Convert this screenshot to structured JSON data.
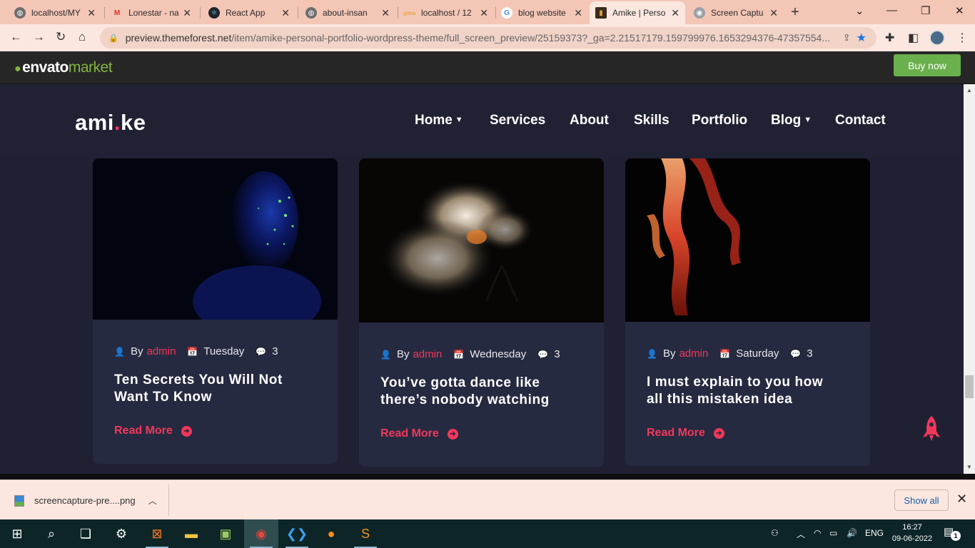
{
  "browser": {
    "tabs": [
      {
        "title": "localhost/MY",
        "icon": "globe-icon"
      },
      {
        "title": "Lonestar - na",
        "icon": "gmail-icon"
      },
      {
        "title": "React App",
        "icon": "react-icon"
      },
      {
        "title": "about-insan",
        "icon": "globe-icon"
      },
      {
        "title": "localhost / 12",
        "icon": "phpmyadmin-icon"
      },
      {
        "title": "blog website",
        "icon": "google-icon"
      },
      {
        "title": "Amike | Perso",
        "icon": "amike-icon",
        "active": true
      },
      {
        "title": "Screen Captu",
        "icon": "screen-capture-icon"
      }
    ],
    "url_host": "preview.themeforest.net",
    "url_path": "/item/amike-personal-portfolio-wordpress-theme/full_screen_preview/25159373?_ga=2.21517179.159799976.1653294376-47357554..."
  },
  "envato": {
    "logo_main": "envato",
    "logo_sub": "market",
    "buy_label": "Buy now",
    "brand_color": "#82b541"
  },
  "site": {
    "logo_left": "ami",
    "logo_dot": ".",
    "logo_right": "ke",
    "accent": "#f2385a",
    "nav": [
      {
        "label": "Home",
        "dropdown": true
      },
      {
        "label": "Services"
      },
      {
        "label": "About"
      },
      {
        "label": "Skills"
      },
      {
        "label": "Portfolio"
      },
      {
        "label": "Blog",
        "dropdown": true
      },
      {
        "label": "Contact"
      }
    ]
  },
  "posts": [
    {
      "by": "By",
      "author": "admin",
      "day": "Tuesday",
      "comments": "3",
      "title_line1": "Ten Secrets You Will Not",
      "title_line2": "Want To Know",
      "read_more": "Read More"
    },
    {
      "by": "By",
      "author": "admin",
      "day": "Wednesday",
      "comments": "3",
      "title_line1": "You’ve gotta dance like",
      "title_line2": "there’s nobody watching",
      "read_more": "Read More"
    },
    {
      "by": "By",
      "author": "admin",
      "day": "Saturday",
      "comments": "3",
      "title_line1": "I must explain to you how",
      "title_line2": "all this mistaken idea",
      "read_more": "Read More"
    }
  ],
  "downloads": {
    "filename": "screencapture-pre....png",
    "show_all": "Show all"
  },
  "taskbar": {
    "lang": "ENG",
    "time": "16:27",
    "date": "09-06-2022",
    "notification_count": "1"
  }
}
